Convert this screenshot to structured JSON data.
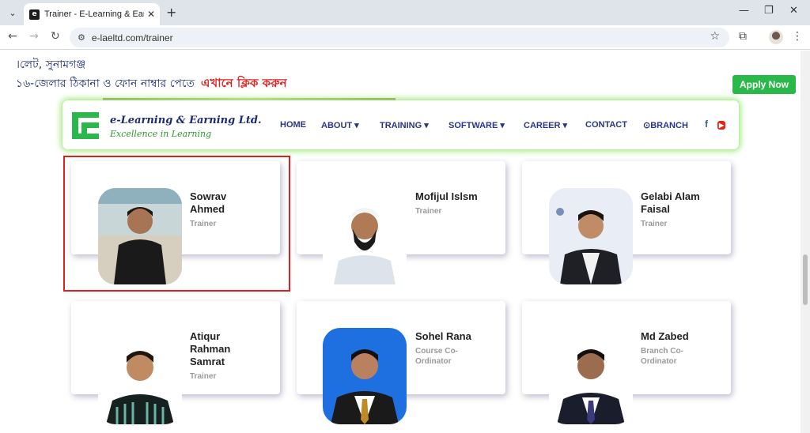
{
  "browser": {
    "tab_title": "Trainer - E-Learning & Earning Ltd.",
    "favicon_letter": "e",
    "url": "e-laeltd.com/trainer"
  },
  "page": {
    "address_line": "।লেট, সুনামগঞ্জ",
    "contact_prompt": "১৬-জেলার ঠিকানা ও ফোন নাম্বার পেতে",
    "contact_link": "এখানে ক্লিক করুন",
    "apply_button": "Apply Now"
  },
  "navbar": {
    "logo_text": "e-Learning & Earning Ltd.",
    "logo_tagline": "Excellence in Learning",
    "items": [
      "HOME",
      "ABOUT",
      "TRAINING",
      "SOFTWARE",
      "CAREER",
      "CONTACT",
      "BRANCH"
    ],
    "dropdown_marker": "⌄"
  },
  "trainers": [
    {
      "name_line1": "Sowrav",
      "name_line2": "Ahmed",
      "name_line3": "",
      "role_line1": "Trainer",
      "role_line2": ""
    },
    {
      "name_line1": "Mofijul Islsm",
      "name_line2": "",
      "name_line3": "",
      "role_line1": "Trainer",
      "role_line2": ""
    },
    {
      "name_line1": "Gelabi Alam",
      "name_line2": "Faisal",
      "name_line3": "",
      "role_line1": "Trainer",
      "role_line2": ""
    },
    {
      "name_line1": "Atiqur",
      "name_line2": "Rahman",
      "name_line3": "Samrat",
      "role_line1": "Trainer",
      "role_line2": ""
    },
    {
      "name_line1": "Sohel Rana",
      "name_line2": "",
      "name_line3": "",
      "role_line1": "Course Co-",
      "role_line2": "Ordinator"
    },
    {
      "name_line1": "Md Zabed",
      "name_line2": "",
      "name_line3": "",
      "role_line1": "Branch Co-",
      "role_line2": "Ordinator"
    }
  ],
  "colors": {
    "brand_navy": "#2a3585",
    "brand_green": "#2ab84a",
    "link_red": "#e02424",
    "highlight": "#e02020"
  }
}
